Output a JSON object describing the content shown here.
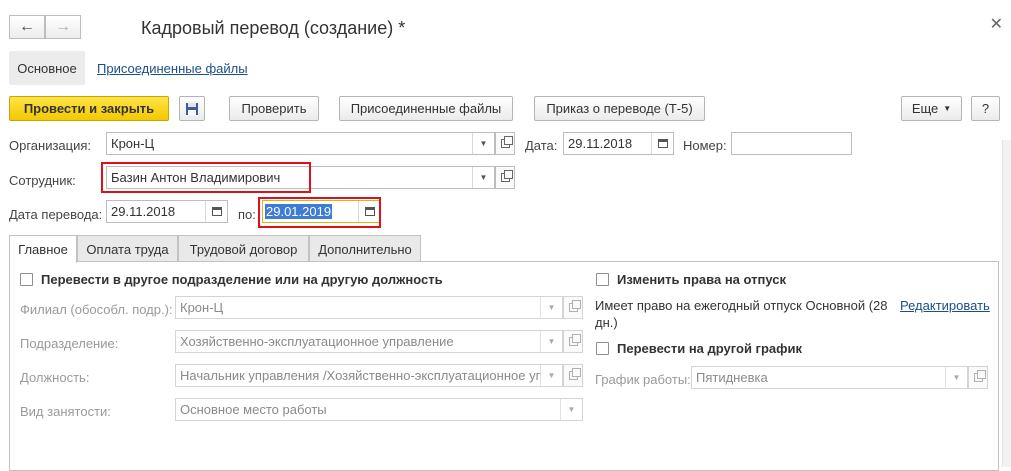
{
  "window": {
    "title": "Кадровый перевод (создание) *"
  },
  "nav_tabs": {
    "main": "Основное",
    "files": "Присоединенные файлы"
  },
  "toolbar": {
    "post_close": "Провести и закрыть",
    "check": "Проверить",
    "files": "Присоединенные файлы",
    "order": "Приказ о переводе (Т-5)",
    "more": "Еще",
    "help": "?"
  },
  "form": {
    "org_label": "Организация:",
    "org_value": "Крон-Ц",
    "date_label": "Дата:",
    "date_value": "29.11.2018",
    "number_label": "Номер:",
    "number_value": "",
    "employee_label": "Сотрудник:",
    "employee_value": "Базин Антон Владимирович",
    "transfer_date_label": "Дата перевода:",
    "transfer_date_value": "29.11.2018",
    "to_label": "по:",
    "to_value": "29.01.2019"
  },
  "tabs": [
    "Главное",
    "Оплата труда",
    "Трудовой договор",
    "Дополнительно"
  ],
  "main_tab": {
    "transfer_check": "Перевести в другое подразделение или на другую должность",
    "branch_label": "Филиал (обособл. подр.):",
    "branch_value": "Крон-Ц",
    "department_label": "Подразделение:",
    "department_value": "Хозяйственно-эксплуатационное управление",
    "position_label": "Должность:",
    "position_value": "Начальник управления /Хозяйственно-эксплуатационное упр",
    "employment_label": "Вид занятости:",
    "employment_value": "Основное место работы",
    "vacation_check": "Изменить права на отпуск",
    "vacation_info_1": "Имеет право на ежегодный отпуск Основной (28",
    "vacation_info_2": "дн.)",
    "edit_link": "Редактировать",
    "schedule_check": "Перевести на другой график",
    "schedule_label": "График работы:",
    "schedule_value": "Пятидневка"
  },
  "colors": {
    "primary_button": "#f5c800",
    "highlight_box": "#e0101a",
    "link": "#1b4f8a",
    "selection": "#3d7bd8"
  }
}
